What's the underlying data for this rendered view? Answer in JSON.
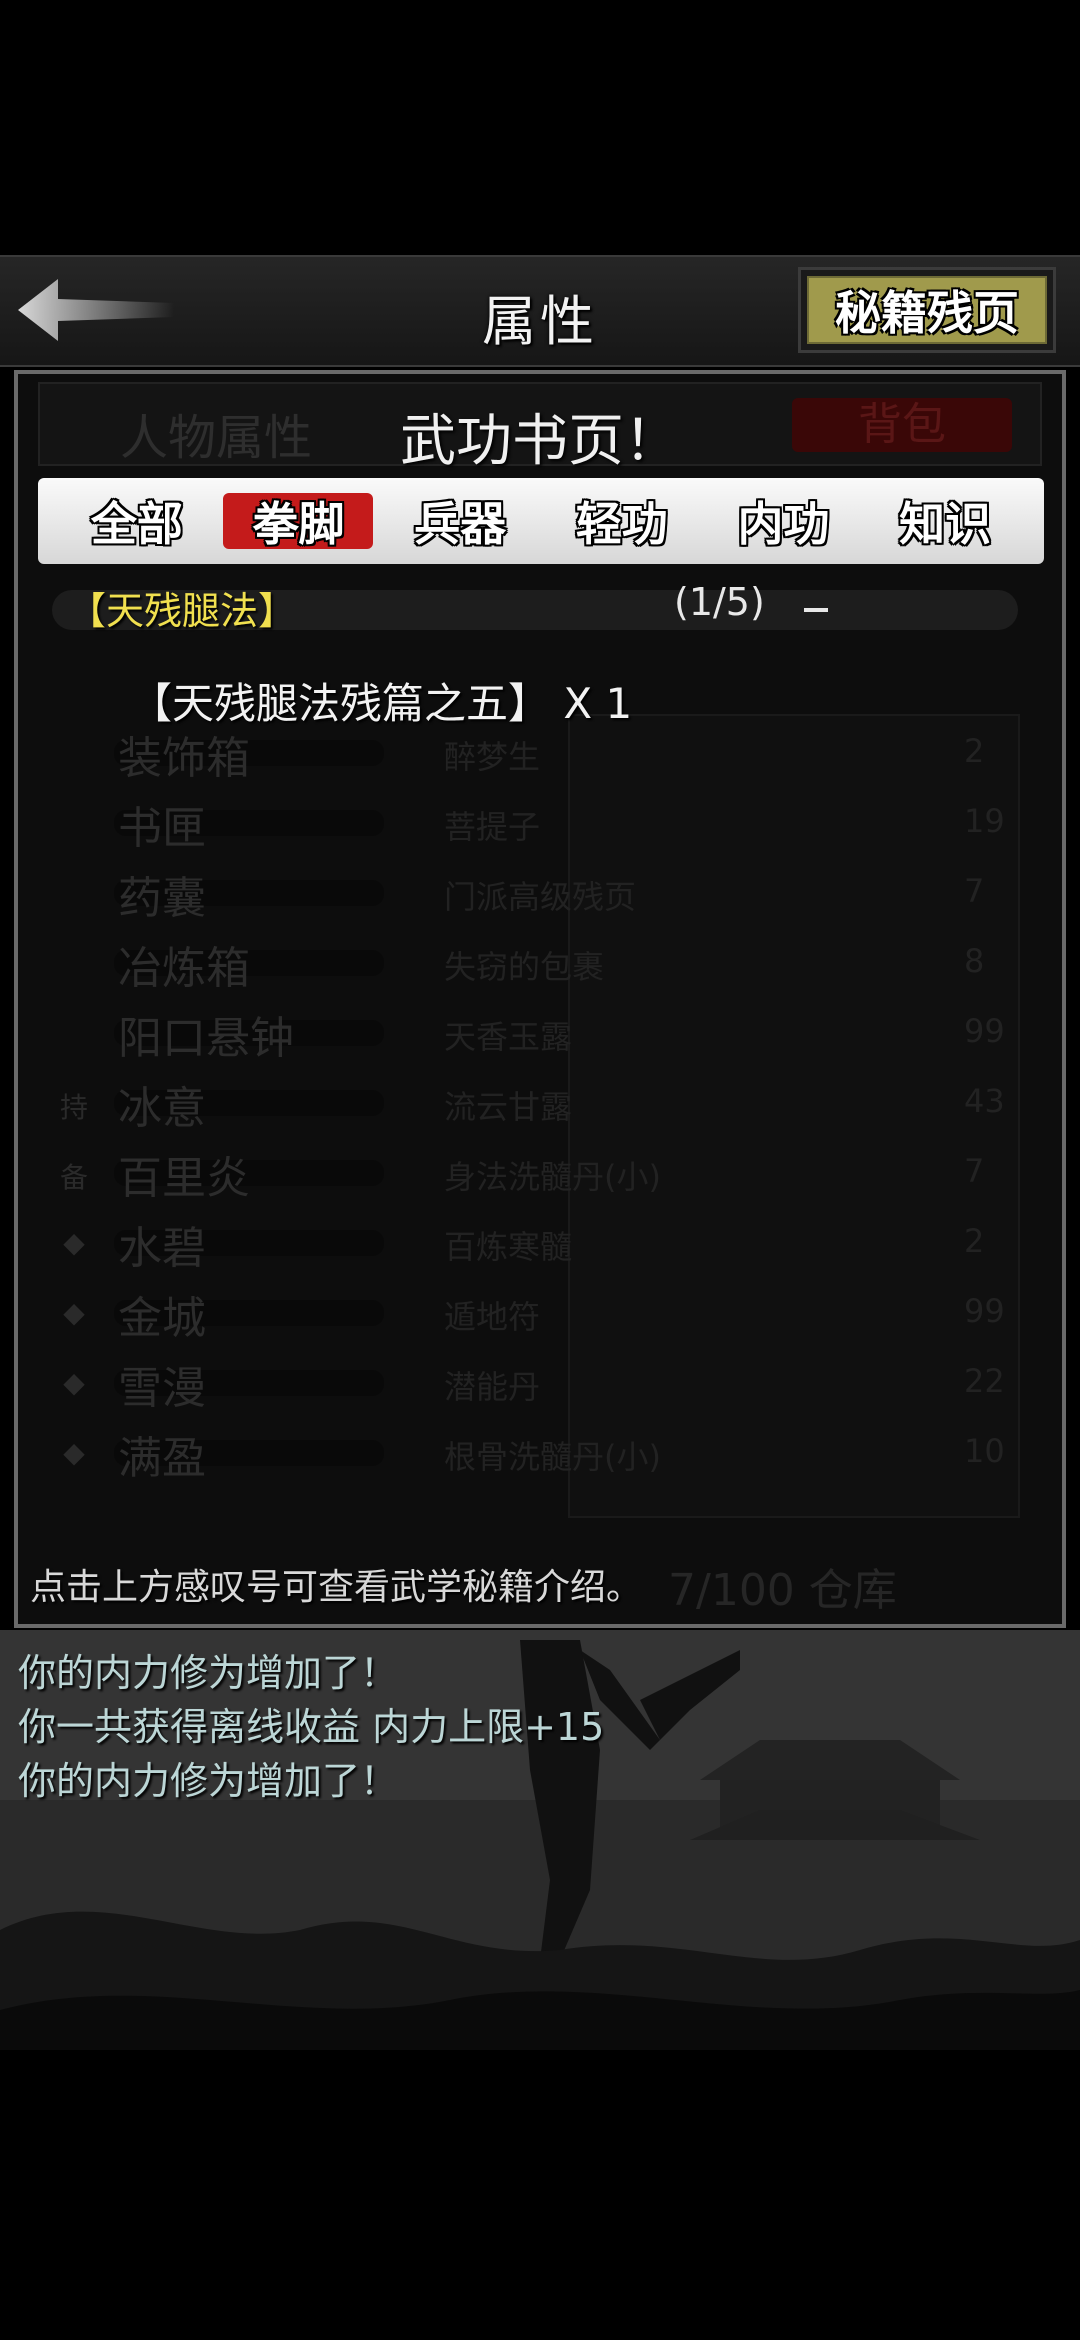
{
  "header": {
    "title": "属性",
    "right_button": "秘籍残页"
  },
  "panel": {
    "title": "武功书页！",
    "tabs": [
      {
        "label": "全部",
        "active": false
      },
      {
        "label": "拳脚",
        "active": true
      },
      {
        "label": "兵器",
        "active": false
      },
      {
        "label": "轻功",
        "active": false
      },
      {
        "label": "内功",
        "active": false
      },
      {
        "label": "知识",
        "active": false
      }
    ],
    "category": {
      "name": "【天残腿法】",
      "progress": "(1/5)"
    },
    "item": "【天残腿法残篇之五】 X 1",
    "hint": "点击上方感叹号可查看武学秘籍介绍。"
  },
  "background_inventory": {
    "left_tab": "人物属性",
    "right_tab": "背包",
    "rows": [
      {
        "marker": "",
        "name": "装饰箱",
        "item": "醉梦生",
        "count": "2"
      },
      {
        "marker": "",
        "name": "书匣",
        "item": "菩提子",
        "count": "19"
      },
      {
        "marker": "",
        "name": "药囊",
        "item": "门派高级残页",
        "count": "7"
      },
      {
        "marker": "",
        "name": "冶炼箱",
        "item": "失窃的包裹",
        "count": "8"
      },
      {
        "marker": "",
        "name": "阳口悬钟",
        "item": "天香玉露",
        "count": "99"
      },
      {
        "marker": "持",
        "name": "冰意",
        "item": "流云甘露",
        "count": "43"
      },
      {
        "marker": "备",
        "name": "百里炎",
        "item": "身法洗髓丹(小)",
        "count": "7"
      },
      {
        "marker": "◆",
        "name": "水碧",
        "item": "百炼寒髓",
        "count": "2"
      },
      {
        "marker": "◆",
        "name": "金城",
        "item": "遁地符",
        "count": "99"
      },
      {
        "marker": "◆",
        "name": "雪漫",
        "item": "潜能丹",
        "count": "22"
      },
      {
        "marker": "◆",
        "name": "满盈",
        "item": "根骨洗髓丹(小)",
        "count": "10"
      }
    ],
    "footer": "7/100 仓库"
  },
  "log": [
    "你的内力修为增加了！",
    "你一共获得离线收益 内力上限+15",
    "你的内力修为增加了！"
  ],
  "colors": {
    "active_tab": "#c41b1b",
    "manual_button": "#a09a4c",
    "category_text": "#f1e04f",
    "log_text": "#bcd6d6"
  }
}
